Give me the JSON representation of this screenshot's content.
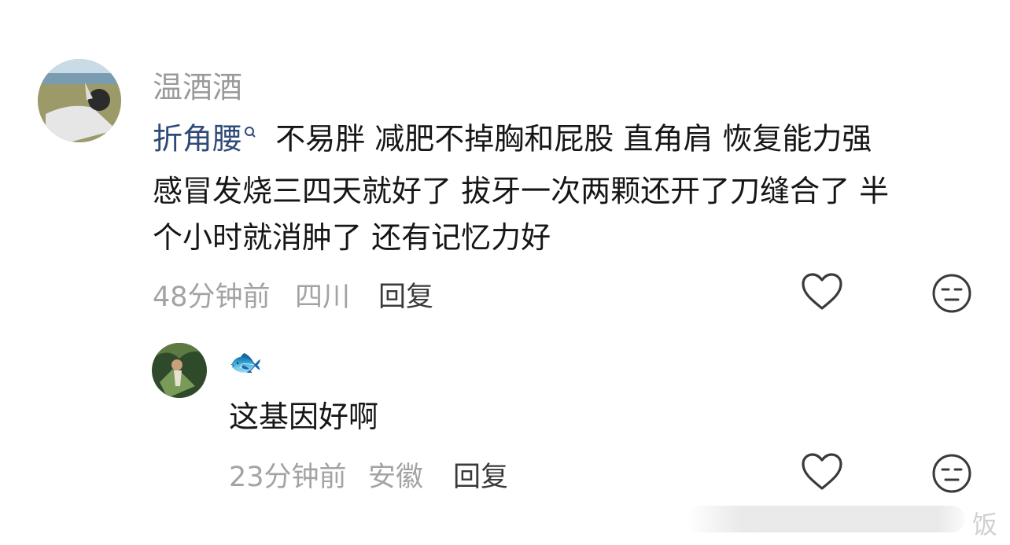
{
  "comment": {
    "username": "温酒酒",
    "tag_text": "折角腰",
    "text_line1": "不易胖 减肥不掉胸和屁股 直角肩 恢复能力强",
    "text_line2": "感冒发烧三四天就好了 拔牙一次两颗还开了刀缝合了 半",
    "text_line3": "个小时就消肿了 还有记忆力好",
    "time": "48分钟前",
    "location": "四川",
    "reply_label": "回复"
  },
  "reply": {
    "username_emoji": "🐟",
    "text": "这基因好啊",
    "time": "23分钟前",
    "location": "安徽",
    "reply_label": "回复"
  },
  "watermark": "饭",
  "icons": [
    "search-icon",
    "heart-icon",
    "meh-face-icon",
    "fish-emoji"
  ]
}
